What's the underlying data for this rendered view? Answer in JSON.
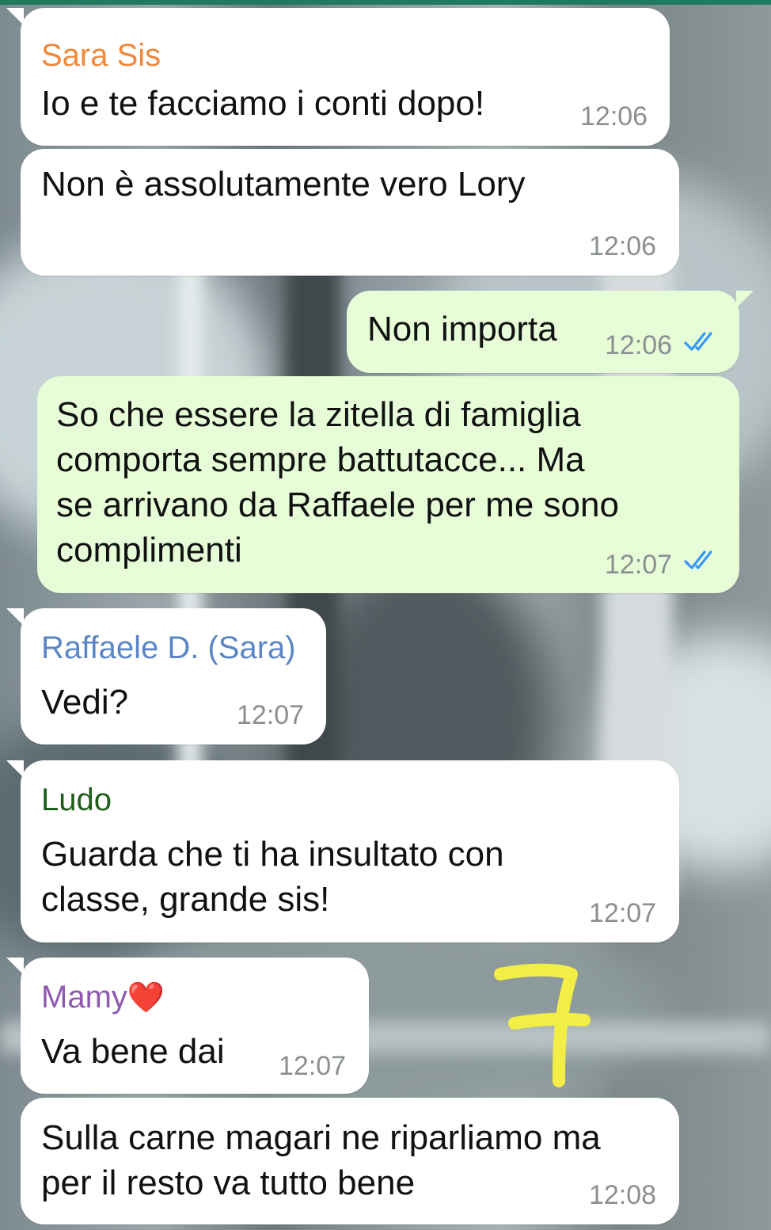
{
  "colors": {
    "sender_sara": "#f0883a",
    "sender_raffaele": "#5b86c5",
    "sender_ludo": "#1e5e1a",
    "sender_mamy": "#8e5ab0",
    "incoming_bubble": "#ffffff",
    "outgoing_bubble": "#e7fdd8",
    "read_ticks": "#3497f9",
    "annotation_yellow": "#f2ee45"
  },
  "messages": [
    {
      "sender": "Sara Sis",
      "text": "Io e te facciamo i conti dopo!",
      "time": "12:06"
    },
    {
      "text": "Non è assolutamente vero Lory",
      "time": "12:06"
    },
    {
      "text": "Non importa",
      "time": "12:06",
      "status_icon": "double-check-read-icon"
    },
    {
      "text": "So che essere la zitella di famiglia\ncomporta sempre battutacce... Ma\nse arrivano da Raffaele per me sono\ncomplimenti",
      "time": "12:07",
      "status_icon": "double-check-read-icon"
    },
    {
      "sender": "Raffaele D. (Sara)",
      "text": "Vedi?",
      "time": "12:07"
    },
    {
      "sender": "Ludo",
      "text": "Guarda che ti ha insultato con\nclasse, grande sis!",
      "time": "12:07"
    },
    {
      "sender": "Mamy",
      "sender_emoji": "❤️",
      "text": "Va bene dai",
      "time": "12:07"
    },
    {
      "text": "Sulla carne magari ne riparliamo ma\nper il resto va tutto bene",
      "time": "12:08"
    }
  ],
  "annotation": {
    "text": "7"
  }
}
